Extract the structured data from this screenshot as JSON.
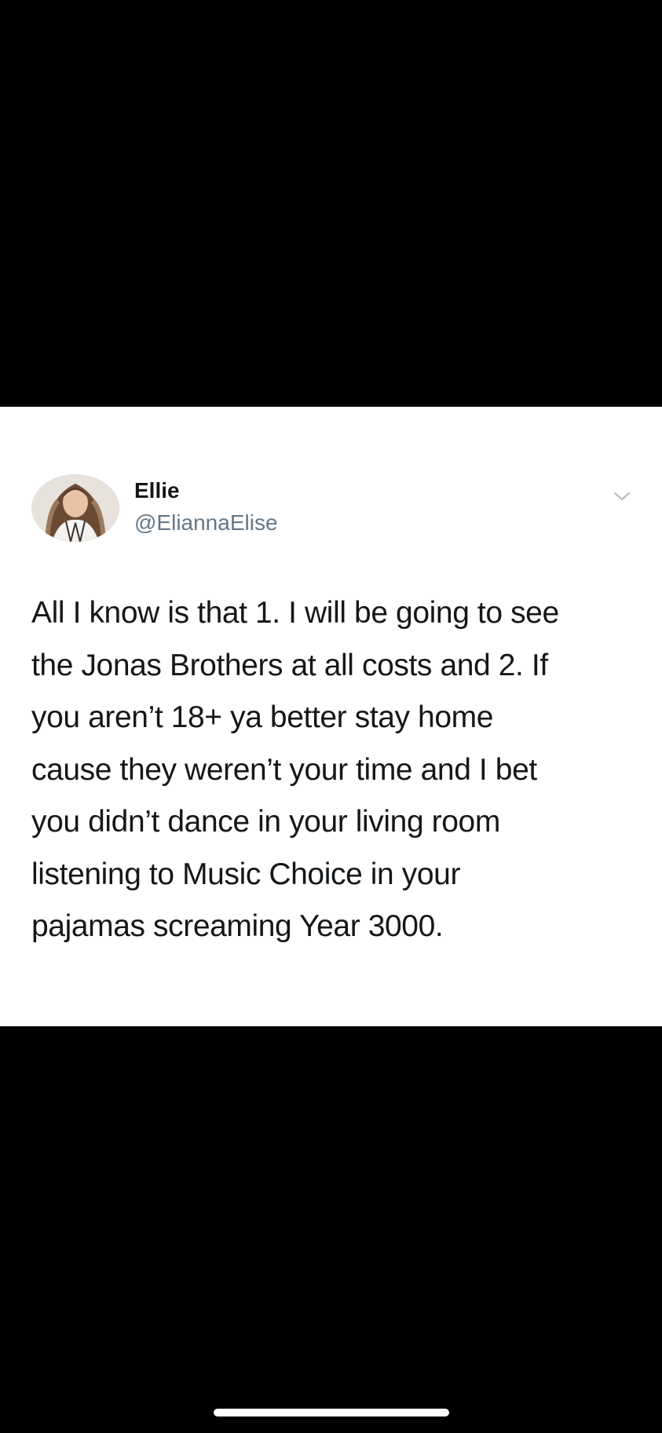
{
  "tweet": {
    "display_name": "Ellie",
    "handle": "@EliannaElise",
    "text_lines": [
      "All I know is that 1. I will be going to see",
      "the Jonas Brothers at all costs and 2. If",
      "you aren’t 18+ ya better stay home",
      "cause they weren’t your time and I bet",
      "you didn’t dance in your living room",
      "listening to Music Choice in your",
      "pajamas screaming Year 3000."
    ],
    "avatar_icon": "profile-photo",
    "menu_icon": "chevron-down-icon"
  },
  "colors": {
    "background": "#000000",
    "card": "#ffffff",
    "text": "#14171a",
    "secondary_text": "#657786",
    "chevron": "#aab8c2"
  }
}
